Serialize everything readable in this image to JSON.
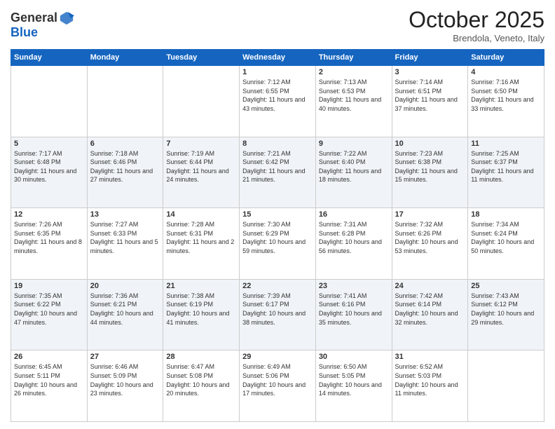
{
  "header": {
    "logo_general": "General",
    "logo_blue": "Blue",
    "month": "October 2025",
    "location": "Brendola, Veneto, Italy"
  },
  "weekdays": [
    "Sunday",
    "Monday",
    "Tuesday",
    "Wednesday",
    "Thursday",
    "Friday",
    "Saturday"
  ],
  "weeks": [
    [
      {
        "day": "",
        "info": ""
      },
      {
        "day": "",
        "info": ""
      },
      {
        "day": "",
        "info": ""
      },
      {
        "day": "1",
        "info": "Sunrise: 7:12 AM\nSunset: 6:55 PM\nDaylight: 11 hours and 43 minutes."
      },
      {
        "day": "2",
        "info": "Sunrise: 7:13 AM\nSunset: 6:53 PM\nDaylight: 11 hours and 40 minutes."
      },
      {
        "day": "3",
        "info": "Sunrise: 7:14 AM\nSunset: 6:51 PM\nDaylight: 11 hours and 37 minutes."
      },
      {
        "day": "4",
        "info": "Sunrise: 7:16 AM\nSunset: 6:50 PM\nDaylight: 11 hours and 33 minutes."
      }
    ],
    [
      {
        "day": "5",
        "info": "Sunrise: 7:17 AM\nSunset: 6:48 PM\nDaylight: 11 hours and 30 minutes."
      },
      {
        "day": "6",
        "info": "Sunrise: 7:18 AM\nSunset: 6:46 PM\nDaylight: 11 hours and 27 minutes."
      },
      {
        "day": "7",
        "info": "Sunrise: 7:19 AM\nSunset: 6:44 PM\nDaylight: 11 hours and 24 minutes."
      },
      {
        "day": "8",
        "info": "Sunrise: 7:21 AM\nSunset: 6:42 PM\nDaylight: 11 hours and 21 minutes."
      },
      {
        "day": "9",
        "info": "Sunrise: 7:22 AM\nSunset: 6:40 PM\nDaylight: 11 hours and 18 minutes."
      },
      {
        "day": "10",
        "info": "Sunrise: 7:23 AM\nSunset: 6:38 PM\nDaylight: 11 hours and 15 minutes."
      },
      {
        "day": "11",
        "info": "Sunrise: 7:25 AM\nSunset: 6:37 PM\nDaylight: 11 hours and 11 minutes."
      }
    ],
    [
      {
        "day": "12",
        "info": "Sunrise: 7:26 AM\nSunset: 6:35 PM\nDaylight: 11 hours and 8 minutes."
      },
      {
        "day": "13",
        "info": "Sunrise: 7:27 AM\nSunset: 6:33 PM\nDaylight: 11 hours and 5 minutes."
      },
      {
        "day": "14",
        "info": "Sunrise: 7:28 AM\nSunset: 6:31 PM\nDaylight: 11 hours and 2 minutes."
      },
      {
        "day": "15",
        "info": "Sunrise: 7:30 AM\nSunset: 6:29 PM\nDaylight: 10 hours and 59 minutes."
      },
      {
        "day": "16",
        "info": "Sunrise: 7:31 AM\nSunset: 6:28 PM\nDaylight: 10 hours and 56 minutes."
      },
      {
        "day": "17",
        "info": "Sunrise: 7:32 AM\nSunset: 6:26 PM\nDaylight: 10 hours and 53 minutes."
      },
      {
        "day": "18",
        "info": "Sunrise: 7:34 AM\nSunset: 6:24 PM\nDaylight: 10 hours and 50 minutes."
      }
    ],
    [
      {
        "day": "19",
        "info": "Sunrise: 7:35 AM\nSunset: 6:22 PM\nDaylight: 10 hours and 47 minutes."
      },
      {
        "day": "20",
        "info": "Sunrise: 7:36 AM\nSunset: 6:21 PM\nDaylight: 10 hours and 44 minutes."
      },
      {
        "day": "21",
        "info": "Sunrise: 7:38 AM\nSunset: 6:19 PM\nDaylight: 10 hours and 41 minutes."
      },
      {
        "day": "22",
        "info": "Sunrise: 7:39 AM\nSunset: 6:17 PM\nDaylight: 10 hours and 38 minutes."
      },
      {
        "day": "23",
        "info": "Sunrise: 7:41 AM\nSunset: 6:16 PM\nDaylight: 10 hours and 35 minutes."
      },
      {
        "day": "24",
        "info": "Sunrise: 7:42 AM\nSunset: 6:14 PM\nDaylight: 10 hours and 32 minutes."
      },
      {
        "day": "25",
        "info": "Sunrise: 7:43 AM\nSunset: 6:12 PM\nDaylight: 10 hours and 29 minutes."
      }
    ],
    [
      {
        "day": "26",
        "info": "Sunrise: 6:45 AM\nSunset: 5:11 PM\nDaylight: 10 hours and 26 minutes."
      },
      {
        "day": "27",
        "info": "Sunrise: 6:46 AM\nSunset: 5:09 PM\nDaylight: 10 hours and 23 minutes."
      },
      {
        "day": "28",
        "info": "Sunrise: 6:47 AM\nSunset: 5:08 PM\nDaylight: 10 hours and 20 minutes."
      },
      {
        "day": "29",
        "info": "Sunrise: 6:49 AM\nSunset: 5:06 PM\nDaylight: 10 hours and 17 minutes."
      },
      {
        "day": "30",
        "info": "Sunrise: 6:50 AM\nSunset: 5:05 PM\nDaylight: 10 hours and 14 minutes."
      },
      {
        "day": "31",
        "info": "Sunrise: 6:52 AM\nSunset: 5:03 PM\nDaylight: 10 hours and 11 minutes."
      },
      {
        "day": "",
        "info": ""
      }
    ]
  ]
}
